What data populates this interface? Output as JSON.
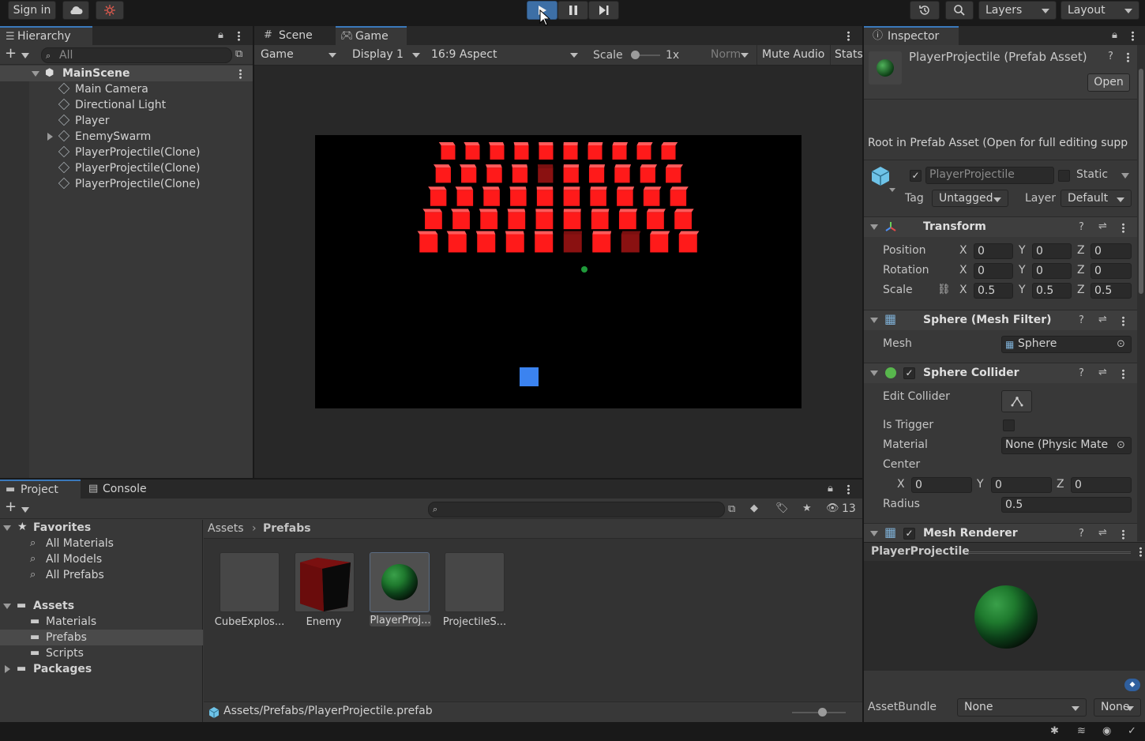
{
  "toolbar": {
    "sign_in": "Sign in",
    "layers": "Layers",
    "layout": "Layout"
  },
  "hierarchy": {
    "tab": "Hierarchy",
    "search_placeholder": "All",
    "scene": "MainScene",
    "items": [
      "Main Camera",
      "Directional Light",
      "Player",
      "EnemySwarm",
      "PlayerProjectile(Clone)",
      "PlayerProjectile(Clone)",
      "PlayerProjectile(Clone)"
    ]
  },
  "view_tabs": {
    "scene": "Scene",
    "game": "Game"
  },
  "game_toolbar": {
    "mode": "Game",
    "display": "Display 1",
    "aspect": "16:9 Aspect",
    "scale_label": "Scale",
    "scale_value": "1x",
    "norm": "Norm",
    "mute_audio": "Mute Audio",
    "stats": "Stats"
  },
  "game_view": {
    "enemy_rows": 5,
    "enemy_cols": 10,
    "enemy_color": "#ff1a1a",
    "player_color": "#3b83f0",
    "projectile_color": "#1f9a3a"
  },
  "inspector": {
    "tab": "Inspector",
    "asset_title": "PlayerProjectile (Prefab Asset)",
    "open_button": "Open",
    "root_note": "Root in Prefab Asset (Open for full editing supp",
    "object_name": "PlayerProjectile",
    "static_label": "Static",
    "tag_label": "Tag",
    "tag_value": "Untagged",
    "layer_label": "Layer",
    "layer_value": "Default",
    "transform": {
      "title": "Transform",
      "position_label": "Position",
      "rotation_label": "Rotation",
      "scale_label": "Scale",
      "position": [
        "0",
        "0",
        "0"
      ],
      "rotation": [
        "0",
        "0",
        "0"
      ],
      "scale": [
        "0.5",
        "0.5",
        "0.5"
      ],
      "axis_x": "X",
      "axis_y": "Y",
      "axis_z": "Z"
    },
    "mesh_filter": {
      "title": "Sphere (Mesh Filter)",
      "mesh_label": "Mesh",
      "mesh_value": "Sphere"
    },
    "sphere_collider": {
      "title": "Sphere Collider",
      "edit_collider": "Edit Collider",
      "is_trigger": "Is Trigger",
      "material_label": "Material",
      "material_value": "None (Physic Mate",
      "center_label": "Center",
      "center": [
        "0",
        "0",
        "0"
      ],
      "radius_label": "Radius",
      "radius_value": "0.5"
    },
    "mesh_renderer": {
      "title": "Mesh Renderer"
    },
    "preview_title": "PlayerProjectile",
    "assetbundle_label": "AssetBundle",
    "assetbundle_value": "None",
    "assetbundle_variant": "None"
  },
  "project": {
    "tab_project": "Project",
    "tab_console": "Console",
    "hidden_count": "13",
    "favorites": "Favorites",
    "fav_items": [
      "All Materials",
      "All Models",
      "All Prefabs"
    ],
    "assets": "Assets",
    "asset_folders": [
      "Materials",
      "Prefabs",
      "Scripts"
    ],
    "packages": "Packages",
    "breadcrumb_root": "Assets",
    "breadcrumb_current": "Prefabs",
    "grid_items": [
      "CubeExplos...",
      "Enemy",
      "PlayerProj...",
      "ProjectileS..."
    ],
    "footer_path": "Assets/Prefabs/PlayerProjectile.prefab"
  }
}
